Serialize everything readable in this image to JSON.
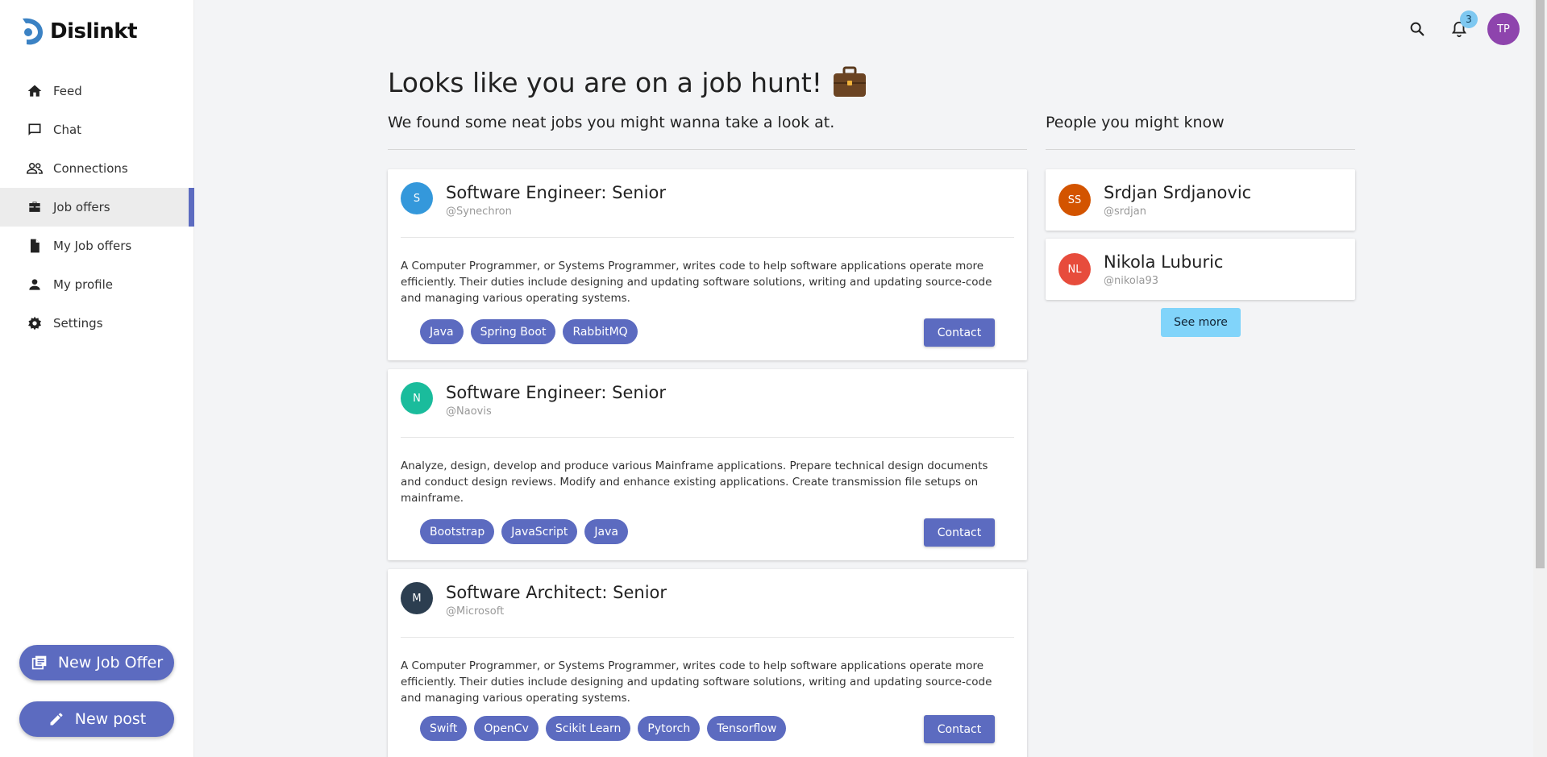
{
  "brand": {
    "name": "Dislinkt",
    "accent": "#5c6bc0"
  },
  "sidebar": {
    "items": [
      {
        "label": "Feed",
        "icon": "home-icon"
      },
      {
        "label": "Chat",
        "icon": "chat-icon"
      },
      {
        "label": "Connections",
        "icon": "people-icon"
      },
      {
        "label": "Job offers",
        "icon": "briefcase-icon",
        "active": true
      },
      {
        "label": "My Job offers",
        "icon": "document-icon"
      },
      {
        "label": "My profile",
        "icon": "person-icon"
      },
      {
        "label": "Settings",
        "icon": "gear-icon"
      }
    ],
    "new_job_offer_label": "New Job Offer",
    "new_post_label": "New post"
  },
  "topbar": {
    "notification_count": "3",
    "user_initials": "TP"
  },
  "main": {
    "heading": "Looks like you are on a job hunt!",
    "subheading": "We found some neat jobs you might wanna take a look at.",
    "jobs": [
      {
        "initial": "S",
        "avatar_color": "#3498db",
        "title": "Software Engineer: Senior",
        "company": "@Synechron",
        "description": "A Computer Programmer, or Systems Programmer, writes code to help software applications operate more efficiently. Their duties include designing and updating software solutions, writing and updating source-code and managing various operating systems.",
        "tags": [
          "Java",
          "Spring Boot",
          "RabbitMQ"
        ],
        "contact_label": "Contact"
      },
      {
        "initial": "N",
        "avatar_color": "#1abc9c",
        "title": "Software Engineer: Senior",
        "company": "@Naovis",
        "description": "Analyze, design, develop and produce various Mainframe applications. Prepare technical design documents and conduct design reviews. Modify and enhance existing applications. Create transmission file setups on mainframe.",
        "tags": [
          "Bootstrap",
          "JavaScript",
          "Java"
        ],
        "contact_label": "Contact"
      },
      {
        "initial": "M",
        "avatar_color": "#2c3e50",
        "title": "Software Architect: Senior",
        "company": "@Microsoft",
        "description": "A Computer Programmer, or Systems Programmer, writes code to help software applications operate more efficiently. Their duties include designing and updating software solutions, writing and updating source-code and managing various operating systems.",
        "tags": [
          "Swift",
          "OpenCv",
          "Scikit Learn",
          "Pytorch",
          "Tensorflow"
        ],
        "contact_label": "Contact"
      }
    ]
  },
  "people": {
    "heading": "People you might know",
    "list": [
      {
        "initials": "SS",
        "avatar_color": "#d35400",
        "name": "Srdjan Srdjanovic",
        "handle": "@srdjan"
      },
      {
        "initials": "NL",
        "avatar_color": "#e74c3c",
        "name": "Nikola Luburic",
        "handle": "@nikola93"
      }
    ],
    "see_more_label": "See more"
  }
}
